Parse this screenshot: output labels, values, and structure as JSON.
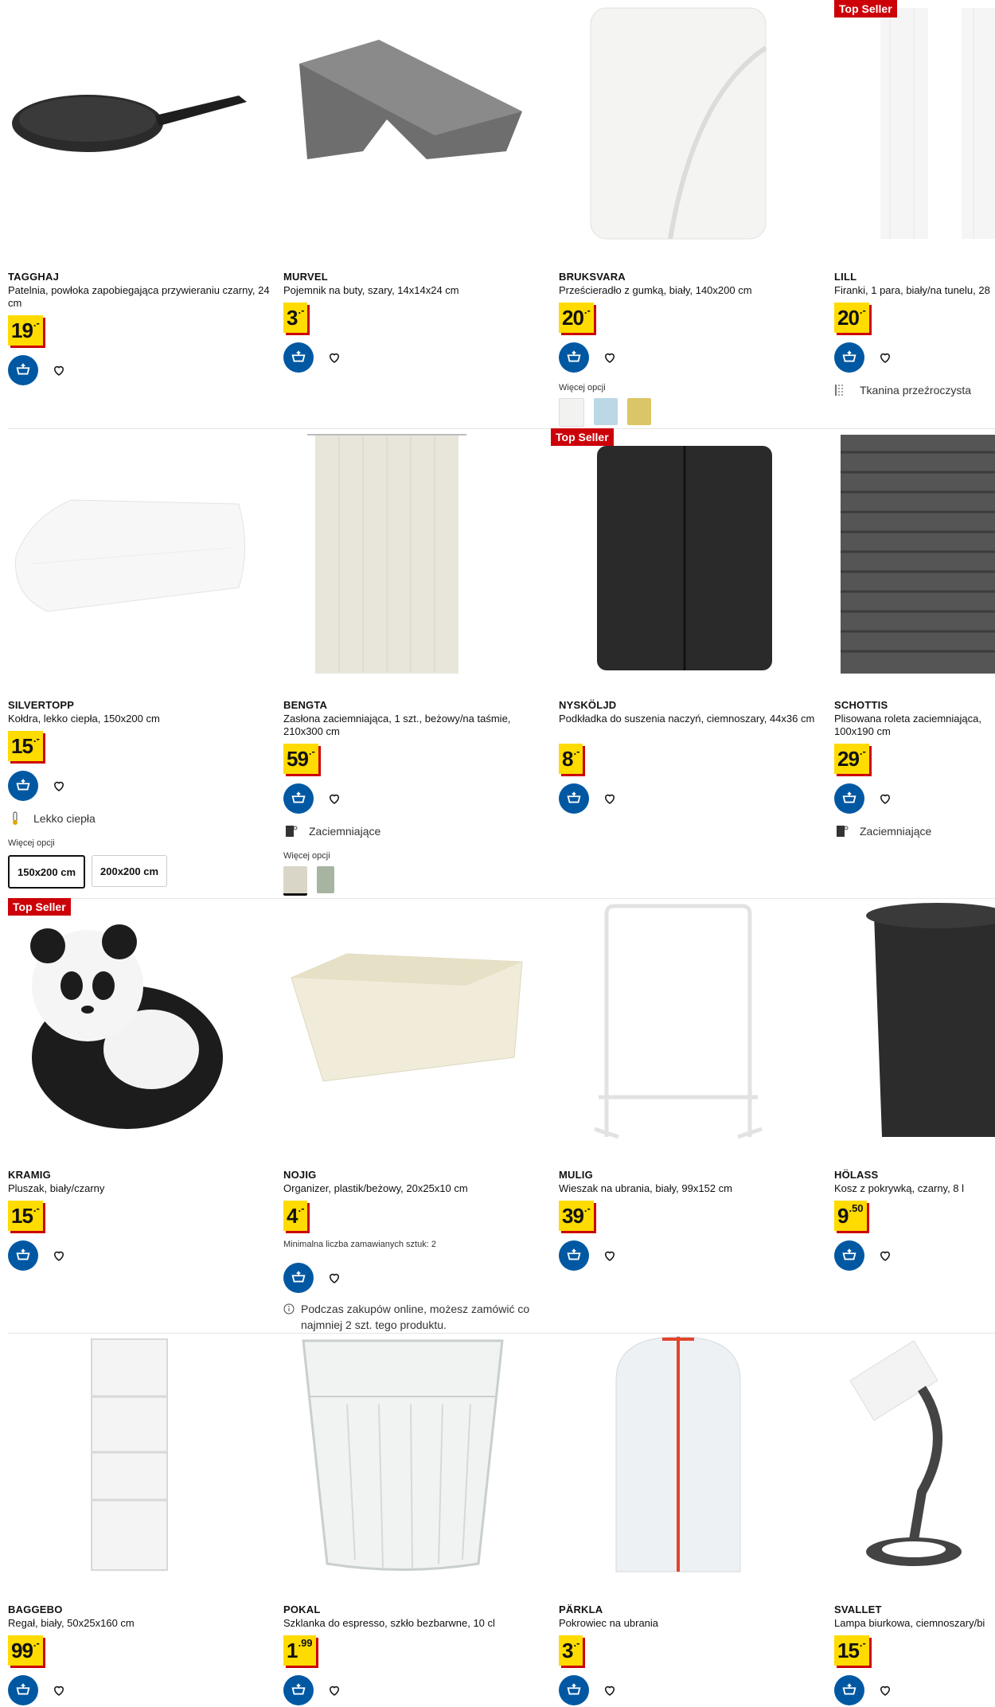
{
  "badges": {
    "top_seller": "Top Seller"
  },
  "products": [
    {
      "name": "TAGGHAJ",
      "desc": "Patelnia, powłoka zapobiegająca przywieraniu czarny, 24 cm",
      "price_int": "19",
      "price_dec": ".-"
    },
    {
      "name": "MURVEL",
      "desc": "Pojemnik na buty, szary, 14x14x24 cm",
      "price_int": "3",
      "price_dec": ".-"
    },
    {
      "name": "BRUKSVARA",
      "desc": "Prześcieradło z gumką, biały, 140x200 cm",
      "price_int": "20",
      "price_dec": ".-",
      "more_label": "Więcej opcji"
    },
    {
      "name": "LILL",
      "desc": "Firanki, 1 para, biały/na tunelu, 28",
      "price_int": "20",
      "price_dec": ".-",
      "feature": "Tkanina przeźroczysta"
    },
    {
      "name": "SILVERTOPP",
      "desc": "Kołdra, lekko ciepła, 150x200 cm",
      "price_int": "15",
      "price_dec": ".-",
      "feature": "Lekko ciepła",
      "more_label": "Więcej opcji",
      "sizes": [
        "150x200 cm",
        "200x200 cm"
      ]
    },
    {
      "name": "BENGTA",
      "desc": "Zasłona zaciemniająca, 1 szt., beżowy/na taśmie, 210x300 cm",
      "price_int": "59",
      "price_dec": ".-",
      "feature": "Zaciemniające",
      "more_label": "Więcej opcji"
    },
    {
      "name": "NYSKÖLJD",
      "desc": "Podkładka do suszenia naczyń, ciemnoszary, 44x36 cm",
      "price_int": "8",
      "price_dec": ".-"
    },
    {
      "name": "SCHOTTIS",
      "desc": "Plisowana roleta zaciemniająca, 100x190 cm",
      "price_int": "29",
      "price_dec": ".-",
      "feature": "Zaciemniające"
    },
    {
      "name": "KRAMIG",
      "desc": "Pluszak, biały/czarny",
      "price_int": "15",
      "price_dec": ".-"
    },
    {
      "name": "NOJIG",
      "desc": "Organizer, plastik/beżowy, 20x25x10 cm",
      "price_int": "4",
      "price_dec": ".-",
      "min_qty": "Minimalna liczba zamawianych sztuk: 2",
      "note": "Podczas zakupów online, możesz zamówić co najmniej 2 szt. tego produktu."
    },
    {
      "name": "MULIG",
      "desc": "Wieszak na ubrania, biały, 99x152 cm",
      "price_int": "39",
      "price_dec": ".-"
    },
    {
      "name": "HÖLASS",
      "desc": "Kosz z pokrywką, czarny, 8 l",
      "price_int": "9",
      "price_dec": ".50"
    },
    {
      "name": "BAGGEBO",
      "desc": "Regał, biały, 50x25x160 cm",
      "price_int": "99",
      "price_dec": ".-"
    },
    {
      "name": "POKAL",
      "desc": "Szklanka do espresso, szkło bezbarwne, 10 cl",
      "price_int": "1",
      "price_dec": ".99"
    },
    {
      "name": "PÄRKLA",
      "desc": "Pokrowiec na ubrania",
      "price_int": "3",
      "price_dec": ".-"
    },
    {
      "name": "SVALLET",
      "desc": "Lampa biurkowa, ciemnoszary/bi",
      "price_int": "15",
      "price_dec": ".-"
    }
  ],
  "colors": {
    "brand_blue": "#0058a3",
    "price_yellow": "#ffdb00",
    "badge_red": "#cc0008"
  },
  "icons": {
    "cart": "add-to-cart-icon",
    "wishlist": "heart-icon",
    "info": "info-icon",
    "sheer": "sheer-fabric-icon",
    "warmth": "thermometer-icon",
    "blackout": "blackout-icon"
  }
}
